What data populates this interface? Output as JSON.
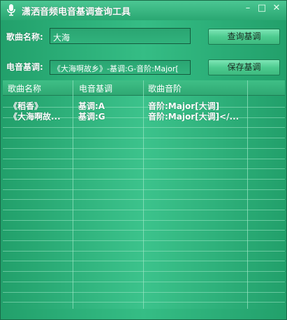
{
  "window": {
    "title": "潇洒音频电音基调查询工具",
    "controls": {
      "minimize": "–",
      "maximize": "□",
      "close": "✕"
    }
  },
  "form": {
    "song_label": "歌曲名称:",
    "song_value": "大海",
    "key_label": "电音基调:",
    "key_value": "《大海啊故乡》-基调:G-音阶:Major[",
    "query_button": "查询基调",
    "save_button": "保存基调"
  },
  "table": {
    "columns": [
      "歌曲名称",
      "电音基调",
      "歌曲音阶"
    ],
    "rows": [
      [
        "《稻香》",
        "基调:A",
        "音阶:Major[大调]"
      ],
      [
        "《大海啊故...",
        "基调:G",
        "音阶:Major[大调]</..."
      ]
    ]
  },
  "icons": {
    "title_icon": "microphone-icon"
  },
  "colors": {
    "theme_green": "#2aa772",
    "text": "#ffffff"
  }
}
